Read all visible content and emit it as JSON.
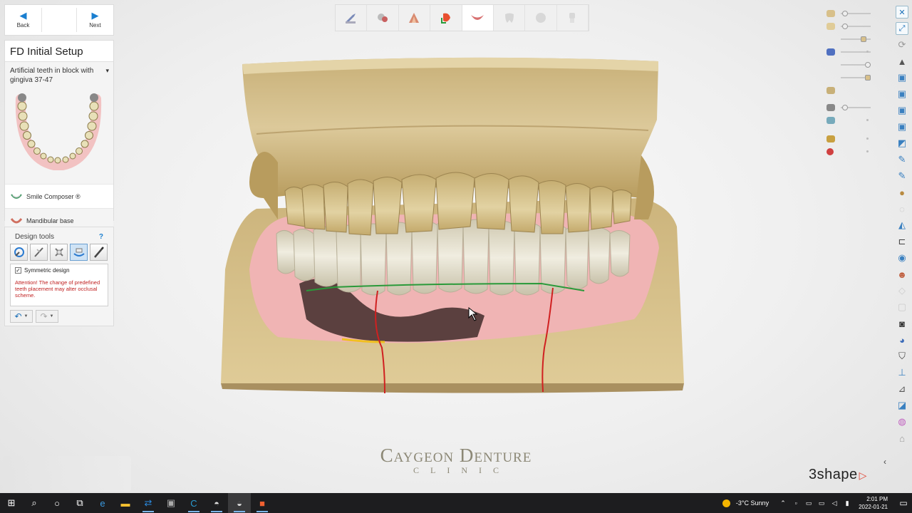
{
  "nav": {
    "back": "Back",
    "next": "Next"
  },
  "step": {
    "title": "FD Initial Setup",
    "subtitle": "Artificial teeth in block with gingiva 37-47",
    "items": [
      {
        "label": "Smile Composer ®"
      },
      {
        "label": "Mandibular base"
      }
    ]
  },
  "tools": {
    "title": "Design tools",
    "help": "?",
    "symmetric_label": "Symmetric design",
    "symmetric_checked": true,
    "warning": "Attention! The change of predefined teeth placement may alter occlusal scheme."
  },
  "clinic": {
    "name": "Caygeon Denture",
    "sub": "CLINIC"
  },
  "brand": "3shape",
  "tray": {
    "temperature": "-3°C",
    "weather": "Sunny",
    "time": "2:01 PM",
    "date": "2022-01-21"
  },
  "colors": {
    "accent": "#1a7fd0",
    "gingiva": "#f0b4b4",
    "teeth": "#eae6d6",
    "model": "#d9c594",
    "margin_line": "#d02020"
  }
}
